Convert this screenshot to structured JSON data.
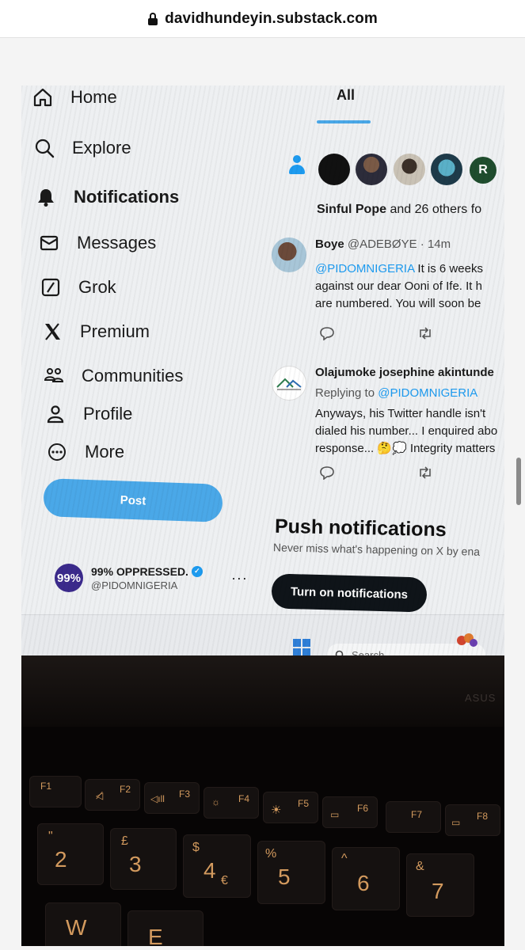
{
  "browser": {
    "url": "davidhundeyin.substack.com"
  },
  "nav": {
    "items": [
      {
        "label": "Home",
        "icon": "home-icon"
      },
      {
        "label": "Explore",
        "icon": "search-icon"
      },
      {
        "label": "Notifications",
        "icon": "bell-icon"
      },
      {
        "label": "Messages",
        "icon": "envelope-icon"
      },
      {
        "label": "Grok",
        "icon": "grok-icon"
      },
      {
        "label": "Premium",
        "icon": "x-logo-icon"
      },
      {
        "label": "Communities",
        "icon": "communities-icon"
      },
      {
        "label": "Profile",
        "icon": "profile-icon"
      },
      {
        "label": "More",
        "icon": "more-icon"
      }
    ],
    "post_label": "Post"
  },
  "account": {
    "avatar_text": "99%",
    "name": "99% OPPRESSED.",
    "handle": "@PIDOMNIGERIA",
    "menu": "···"
  },
  "tabs": {
    "all": "All"
  },
  "notification": {
    "prefix": "Sinful Pope",
    "suffix": " and 26 others fo"
  },
  "tweets": [
    {
      "name": "Boye",
      "handle": "@ADEBØYE · 14m",
      "mention": "@PIDOMNIGERIA",
      "line1_rest": " It is 6 weeks",
      "line2": "against our dear Ooni of Ife. It h",
      "line3": "are numbered. You will soon be"
    },
    {
      "name": "Olajumoke josephine akintunde",
      "replying_prefix": "Replying to ",
      "mention": "@PIDOMNIGERIA",
      "line1": "Anyways, his Twitter handle isn't",
      "line2": "dialed his number... I enquired abo",
      "line3": "response... 🤔💭 Integrity matters"
    }
  ],
  "push": {
    "title": "Push notifications",
    "subtitle": "Never miss what's happening on X by ena",
    "button": "Turn on notifications"
  },
  "taskbar": {
    "search_placeholder": "Search"
  },
  "laptop": {
    "brand": "ASUS"
  },
  "keys": {
    "fn": [
      "F1",
      "F2",
      "F3",
      "F4",
      "F5",
      "F6",
      "F7",
      "F8"
    ],
    "numbers": [
      "2",
      "3",
      "4",
      "5",
      "6",
      "7"
    ],
    "number_symbols": [
      "\"",
      "£",
      "$",
      "%",
      "^",
      "&"
    ],
    "euro": "€",
    "letters": [
      "W",
      "E"
    ]
  }
}
